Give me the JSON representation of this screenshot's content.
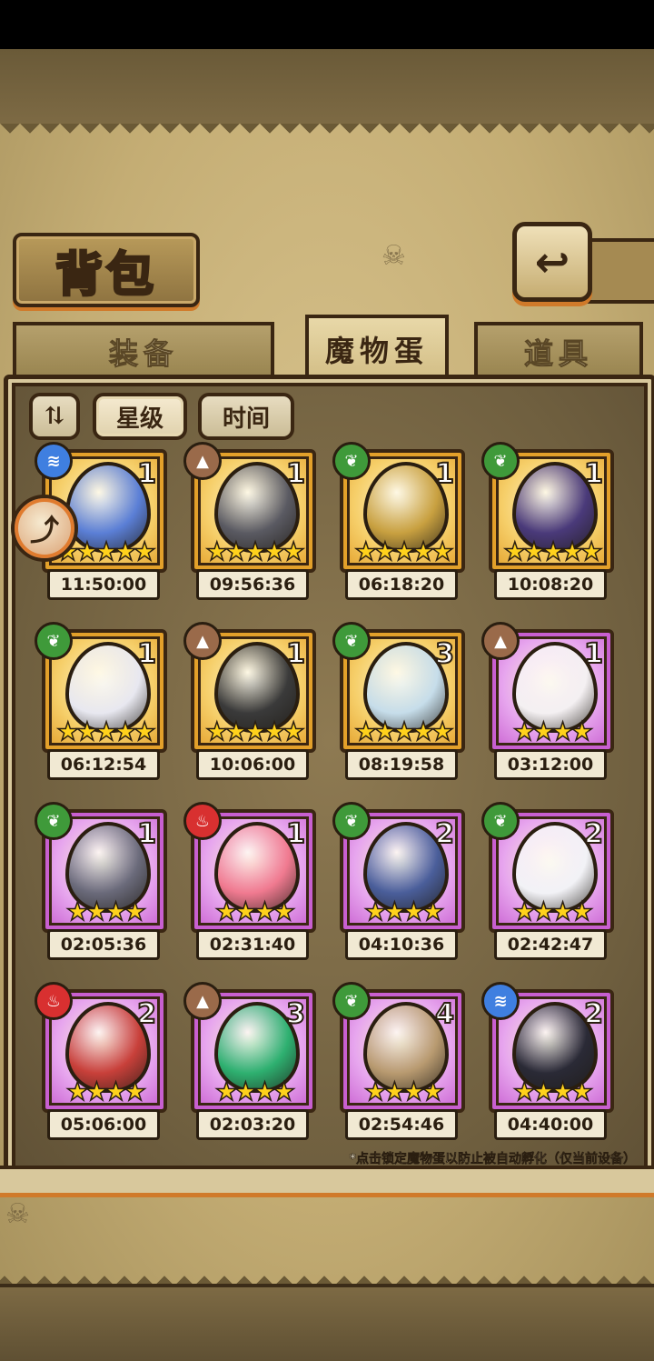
{
  "header": {
    "title": "背包",
    "back_icon": "↩"
  },
  "tabs": [
    {
      "label": "装备",
      "active": false
    },
    {
      "label": "魔物蛋",
      "active": true
    },
    {
      "label": "道具",
      "active": false
    }
  ],
  "sort": {
    "toggle_icon": "⇅",
    "star_label": "星级",
    "time_label": "时间"
  },
  "hint": "*点击锁定魔物蛋以防止被自动孵化（仅当前设备）",
  "colors": {
    "gold_frame": "#e3a02a",
    "purple_frame": "#c85fd0",
    "water": "#3f7fe0",
    "earth": "#9a6a4a",
    "nature": "#3f9a3a",
    "fire": "#d83030"
  },
  "eggs": [
    {
      "count": "1",
      "stars": "★★★★★",
      "time": "11:50:00",
      "element": "water",
      "rarity": "gold",
      "art": "#5b7fd6"
    },
    {
      "count": "1",
      "stars": "★★★★★",
      "time": "09:56:36",
      "element": "earth",
      "rarity": "gold",
      "art": "#5a5a62"
    },
    {
      "count": "1",
      "stars": "★★★★★",
      "time": "06:18:20",
      "element": "nature",
      "rarity": "gold",
      "art": "#c8a040"
    },
    {
      "count": "1",
      "stars": "★★★★★",
      "time": "10:08:20",
      "element": "nature",
      "rarity": "gold",
      "art": "#4a3a7a"
    },
    {
      "count": "1",
      "stars": "★★★★★",
      "time": "06:12:54",
      "element": "nature",
      "rarity": "gold",
      "art": "#e8e8f0"
    },
    {
      "count": "1",
      "stars": "★★★★★",
      "time": "10:06:00",
      "element": "earth",
      "rarity": "gold",
      "art": "#3a3a3a"
    },
    {
      "count": "3",
      "stars": "★★★★★",
      "time": "08:19:58",
      "element": "nature",
      "rarity": "gold",
      "art": "#c6ddea"
    },
    {
      "count": "1",
      "stars": "★★★★",
      "time": "03:12:00",
      "element": "earth",
      "rarity": "purple",
      "art": "#f4f0f2"
    },
    {
      "count": "1",
      "stars": "★★★★",
      "time": "02:05:36",
      "element": "nature",
      "rarity": "purple",
      "art": "#6a6a7a"
    },
    {
      "count": "1",
      "stars": "★★★★",
      "time": "02:31:40",
      "element": "fire",
      "rarity": "purple",
      "art": "#f07a90"
    },
    {
      "count": "2",
      "stars": "★★★★",
      "time": "04:10:36",
      "element": "nature",
      "rarity": "purple",
      "art": "#4a5e9a"
    },
    {
      "count": "2",
      "stars": "★★★★",
      "time": "02:42:47",
      "element": "nature",
      "rarity": "purple",
      "art": "#f2f2f6"
    },
    {
      "count": "2",
      "stars": "★★★★",
      "time": "05:06:00",
      "element": "fire",
      "rarity": "purple",
      "art": "#c8403a"
    },
    {
      "count": "3",
      "stars": "★★★★",
      "time": "02:03:20",
      "element": "earth",
      "rarity": "purple",
      "art": "#2eb070"
    },
    {
      "count": "4",
      "stars": "★★★★",
      "time": "02:54:46",
      "element": "nature",
      "rarity": "purple",
      "art": "#b89a70"
    },
    {
      "count": "2",
      "stars": "★★★★",
      "time": "04:40:00",
      "element": "water",
      "rarity": "purple",
      "art": "#2a2a36"
    }
  ],
  "float_button_icon": "⤴"
}
